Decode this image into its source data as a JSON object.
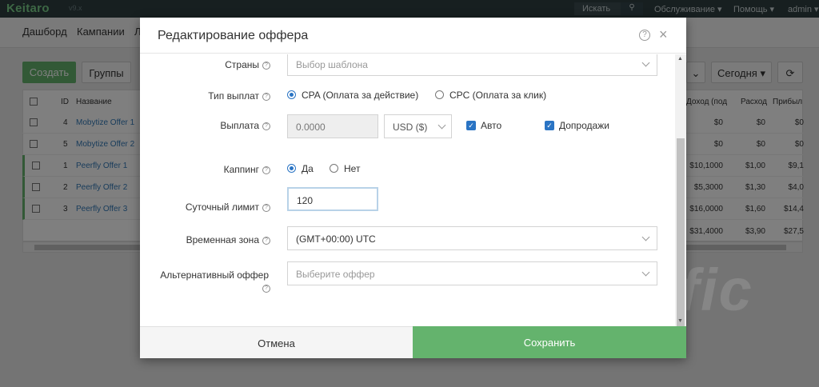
{
  "app": {
    "logo": "Keitaro",
    "version": "v9.x",
    "search_label": "Искать",
    "menu_service": "Обслуживание ▾",
    "menu_help": "Помощь ▾",
    "menu_user": "admin ▾"
  },
  "nav": {
    "dashboard": "Дашборд",
    "campaigns": "Кампании",
    "more": "Л"
  },
  "toolbar": {
    "create": "Создать",
    "groups": "Группы",
    "today": "Сегодня ▾"
  },
  "table": {
    "headers": {
      "id": "ID",
      "name": "Название",
      "revenue": "Доход (под",
      "cost": "Расход",
      "profit": "Прибыл"
    },
    "rows": [
      {
        "id": "4",
        "name": "Mobytize Offer 1",
        "revenue": "$0",
        "cost": "$0",
        "profit": "$0"
      },
      {
        "id": "5",
        "name": "Mobytize Offer 2",
        "revenue": "$0",
        "cost": "$0",
        "profit": "$0"
      },
      {
        "id": "1",
        "name": "Peerfly Offer 1",
        "revenue": "$10,1000",
        "cost": "$1,00",
        "profit": "$9,1"
      },
      {
        "id": "2",
        "name": "Peerfly Offer 2",
        "revenue": "$5,3000",
        "cost": "$1,30",
        "profit": "$4,0"
      },
      {
        "id": "3",
        "name": "Peerfly Offer 3",
        "revenue": "$16,0000",
        "cost": "$1,60",
        "profit": "$14,4"
      }
    ],
    "totals": {
      "revenue": "$31,4000",
      "cost": "$3,90",
      "profit": "$27,5"
    }
  },
  "modal": {
    "title": "Редактирование оффера",
    "help_glyph": "?",
    "close_glyph": "×",
    "countries": {
      "label": "Страны",
      "placeholder": "Выбор шаблона"
    },
    "payout_type": {
      "label": "Тип выплат",
      "cpa": "CPA (Оплата за действие)",
      "cpc": "CPC (Оплата за клик)",
      "selected": "cpa"
    },
    "payout": {
      "label": "Выплата",
      "value": "0.0000",
      "currency": "USD ($)",
      "auto": "Авто",
      "upsells": "Допродажи"
    },
    "capping": {
      "label": "Каппинг",
      "yes": "Да",
      "no": "Нет",
      "selected": "yes"
    },
    "daily_limit": {
      "label": "Суточный лимит",
      "value": "120"
    },
    "timezone": {
      "label": "Временная зона",
      "value": "(GMT+00:00) UTC"
    },
    "alt_offer": {
      "label": "Альтернативный оффер",
      "placeholder": "Выберите оффер"
    },
    "cancel": "Отмена",
    "save": "Сохранить"
  },
  "watermark": "ProTraffic"
}
